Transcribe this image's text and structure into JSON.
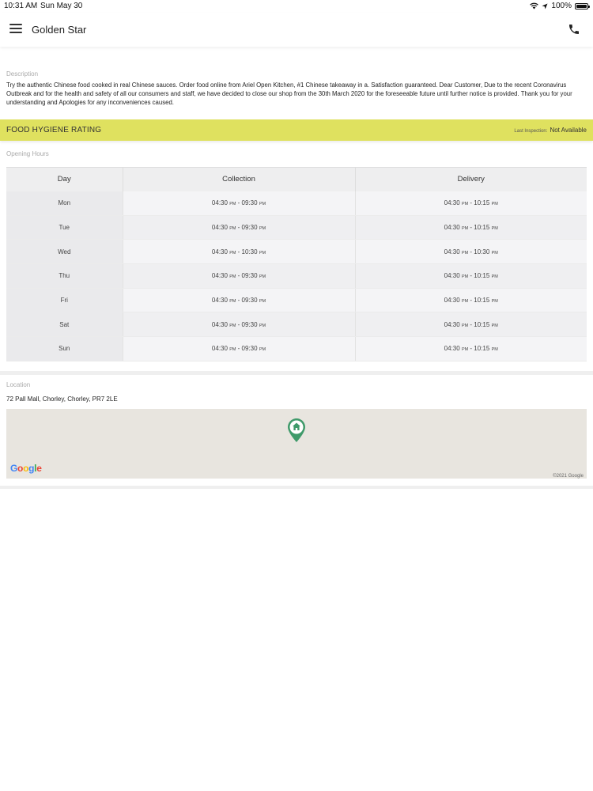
{
  "status_bar": {
    "time": "10:31 AM",
    "date": "Sun May 30",
    "battery": "100%"
  },
  "header": {
    "title": "Golden Star"
  },
  "description": {
    "label": "Description",
    "text": "Try the authentic Chinese food cooked in real Chinese sauces. Order food online from Ariel Open Kitchen, #1 Chinese takeaway in a. Satisfaction guaranteed. Dear Customer, Due to the recent Coronavirus Outbreak and for the health and safety of all our consumers and staff, we have decided to close our shop from the 30th March 2020 for the foreseeable future until further notice is provided. Thank you for your understanding and Apologies for any inconveniences caused."
  },
  "hygiene": {
    "title": "FOOD HYGIENE RATING",
    "last_inspection_label": "Last Inspection:",
    "last_inspection_value": "Not Available"
  },
  "opening_hours": {
    "label": "Opening Hours",
    "headers": [
      "Day",
      "Collection",
      "Delivery"
    ],
    "rows": [
      {
        "day": "Mon",
        "col_open": "04:30",
        "col_close": "09:30",
        "del_open": "04:30",
        "del_close": "10:15"
      },
      {
        "day": "Tue",
        "col_open": "04:30",
        "col_close": "09:30",
        "del_open": "04:30",
        "del_close": "10:15"
      },
      {
        "day": "Wed",
        "col_open": "04:30",
        "col_close": "10:30",
        "del_open": "04:30",
        "del_close": "10:30"
      },
      {
        "day": "Thu",
        "col_open": "04:30",
        "col_close": "09:30",
        "del_open": "04:30",
        "del_close": "10:15"
      },
      {
        "day": "Fri",
        "col_open": "04:30",
        "col_close": "09:30",
        "del_open": "04:30",
        "del_close": "10:15"
      },
      {
        "day": "Sat",
        "col_open": "04:30",
        "col_close": "09:30",
        "del_open": "04:30",
        "del_close": "10:15"
      },
      {
        "day": "Sun",
        "col_open": "04:30",
        "col_close": "09:30",
        "del_open": "04:30",
        "del_close": "10:15"
      }
    ],
    "pm": "PM"
  },
  "location": {
    "label": "Location",
    "address": "72 Pall Mall, Chorley, Chorley, PR7 2LE",
    "map_logo": "Google",
    "map_copyright": "©2021 Google"
  },
  "colors": {
    "hygiene_bar": "#dfe15f",
    "map_pin": "#3f9a6a",
    "map_bg": "#e8e5df"
  }
}
